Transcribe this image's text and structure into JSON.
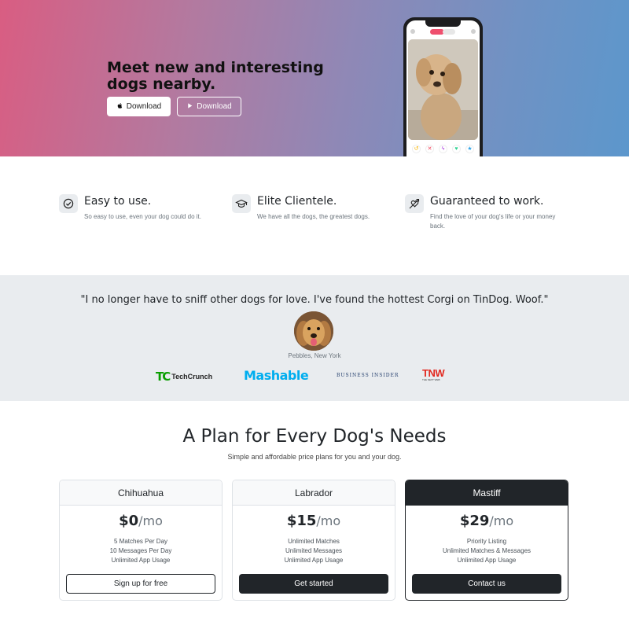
{
  "hero": {
    "title": "Meet new and interesting dogs nearby.",
    "download_apple_label": "Download",
    "download_play_label": "Download",
    "gradient_colors": [
      "#d95d82",
      "#5c97cc"
    ]
  },
  "features": [
    {
      "title": "Easy to use.",
      "text": "So easy to use, even your dog could do it.",
      "icon": "check-circle-icon"
    },
    {
      "title": "Elite Clientele.",
      "text": "We have all the dogs, the greatest dogs.",
      "icon": "graduation-cap-icon"
    },
    {
      "title": "Guaranteed to work.",
      "text": "Find the love of your dog's life or your money back.",
      "icon": "heart-arrow-icon"
    }
  ],
  "testimonial": {
    "quote": "\"I no longer have to sniff other dogs for love. I've found the hottest Corgi on TinDog. Woof.\"",
    "attribution": "Pebbles, New York"
  },
  "press": {
    "techcrunch_mark": "TC",
    "techcrunch_text": "TechCrunch",
    "mashable": "Mashable",
    "business_insider": "BUSINESS INSIDER",
    "tnw": "TNW",
    "tnw_sub": "THE NEXT WEB"
  },
  "pricing": {
    "title": "A Plan for Every Dog's Needs",
    "subtitle": "Simple and affordable price plans for you and your dog.",
    "plans": [
      {
        "name": "Chihuahua",
        "price": "$0",
        "period": "/mo",
        "features": [
          "5 Matches Per Day",
          "10 Messages Per Day",
          "Unlimited App Usage"
        ],
        "button": "Sign up for free"
      },
      {
        "name": "Labrador",
        "price": "$15",
        "period": "/mo",
        "features": [
          "Unlimited Matches",
          "Unlimited Messages",
          "Unlimited App Usage"
        ],
        "button": "Get started"
      },
      {
        "name": "Mastiff",
        "price": "$29",
        "period": "/mo",
        "features": [
          "Priority Listing",
          "Unlimited Matches & Messages",
          "Unlimited App Usage"
        ],
        "button": "Contact us"
      }
    ]
  }
}
